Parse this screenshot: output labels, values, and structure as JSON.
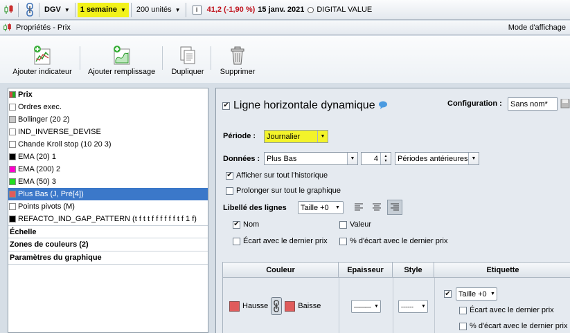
{
  "topbar": {
    "symbol": "DGV",
    "period": "1 semaine",
    "units": "200 unités",
    "info_icon": "i",
    "quote": "41,2 (-1,90 %)",
    "date": "15 janv. 2021",
    "name": "DIGITAL VALUE"
  },
  "titlebar": {
    "title": "Propriétés - Prix",
    "mode": "Mode d'affichage"
  },
  "actions": [
    {
      "label": "Ajouter indicateur"
    },
    {
      "label": "Ajouter remplissage"
    },
    {
      "label": "Dupliquer"
    },
    {
      "label": "Supprimer"
    }
  ],
  "list": {
    "items": [
      {
        "label": "Prix",
        "color": "#d04848"
      },
      {
        "label": "Ordres exec.",
        "color": "#ffffff"
      },
      {
        "label": "Bollinger (20 2)",
        "color": "#c8c8c8"
      },
      {
        "label": "IND_INVERSE_DEVISE",
        "color": "#ffffff"
      },
      {
        "label": "Chande Kroll stop (10 20 3)",
        "color": "#ffffff"
      },
      {
        "label": "EMA (20) 1",
        "color": "#000000"
      },
      {
        "label": "EMA (200) 2",
        "color": "#ff00cc"
      },
      {
        "label": "EMA (50) 3",
        "color": "#22dd22"
      },
      {
        "label": "Plus Bas (J, Pré[4])",
        "color": "#e05c5c"
      },
      {
        "label": "Points pivots (M)",
        "color": "#ffffff"
      },
      {
        "label": "REFACTO_IND_GAP_PATTERN (t f t t f f f f f f t f 1 f)",
        "color": "#000000"
      }
    ],
    "sections": [
      "Échelle",
      "Zones de couleurs (2)",
      "Paramètres du graphique"
    ]
  },
  "props": {
    "title": "Ligne horizontale dynamique",
    "config_label": "Configuration :",
    "config_value": "Sans nom*",
    "periode_label": "Période :",
    "periode_value": "Journalier",
    "donnees_label": "Données :",
    "donnees_value": "Plus Bas",
    "donnees_count": "4",
    "donnees_mode": "Périodes antérieures",
    "afficher_historique": "Afficher sur tout l'historique",
    "prolonger": "Prolonger sur tout le graphique",
    "libelle_label": "Libellé des lignes",
    "libelle_size": "Taille +0",
    "nom": "Nom",
    "valeur": "Valeur",
    "ecart": "Écart avec le dernier prix",
    "pct_ecart": "% d'écart avec le dernier prix"
  },
  "table": {
    "headers": [
      "Couleur",
      "Epaisseur",
      "Style",
      "Etiquette"
    ],
    "hausse": "Hausse",
    "baisse": "Baisse",
    "epaisseur_value": "———",
    "style_value": "------",
    "etiquette_size": "Taille +0",
    "ecart": "Écart avec le dernier prix",
    "pct_ecart": "% d'écart avec le dernier prix"
  }
}
